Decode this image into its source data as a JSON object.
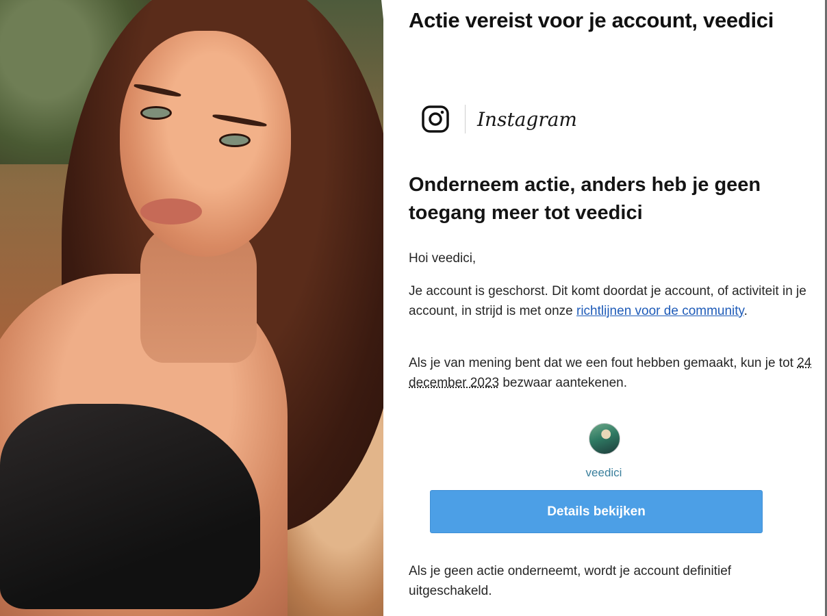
{
  "email": {
    "subject": "Actie vereist voor je account, veedici",
    "brand": {
      "icon": "instagram-icon",
      "wordmark": "Instagram"
    },
    "headline": "Onderneem actie, anders heb je geen toegang meer tot veedici",
    "greeting": "Hoi veedici,",
    "para1": {
      "before": "Je account is geschorst. Dit komt doordat je account, of activiteit in je account, in strijd is met onze ",
      "link": "richtlijnen voor de community",
      "after": "."
    },
    "para2": {
      "before": "Als je van mening bent dat we een fout hebben gemaakt, kun je tot ",
      "date": "24 december 2023",
      "after": " bezwaar aantekenen."
    },
    "profile": {
      "username": "veedici"
    },
    "cta_label": "Details bekijken",
    "para3": "Als je geen actie onderneemt, wordt je account definitief uitgeschakeld."
  },
  "colors": {
    "cta": "#4c9fe6",
    "link": "#1e5bb8",
    "username": "#3a7f9c"
  }
}
